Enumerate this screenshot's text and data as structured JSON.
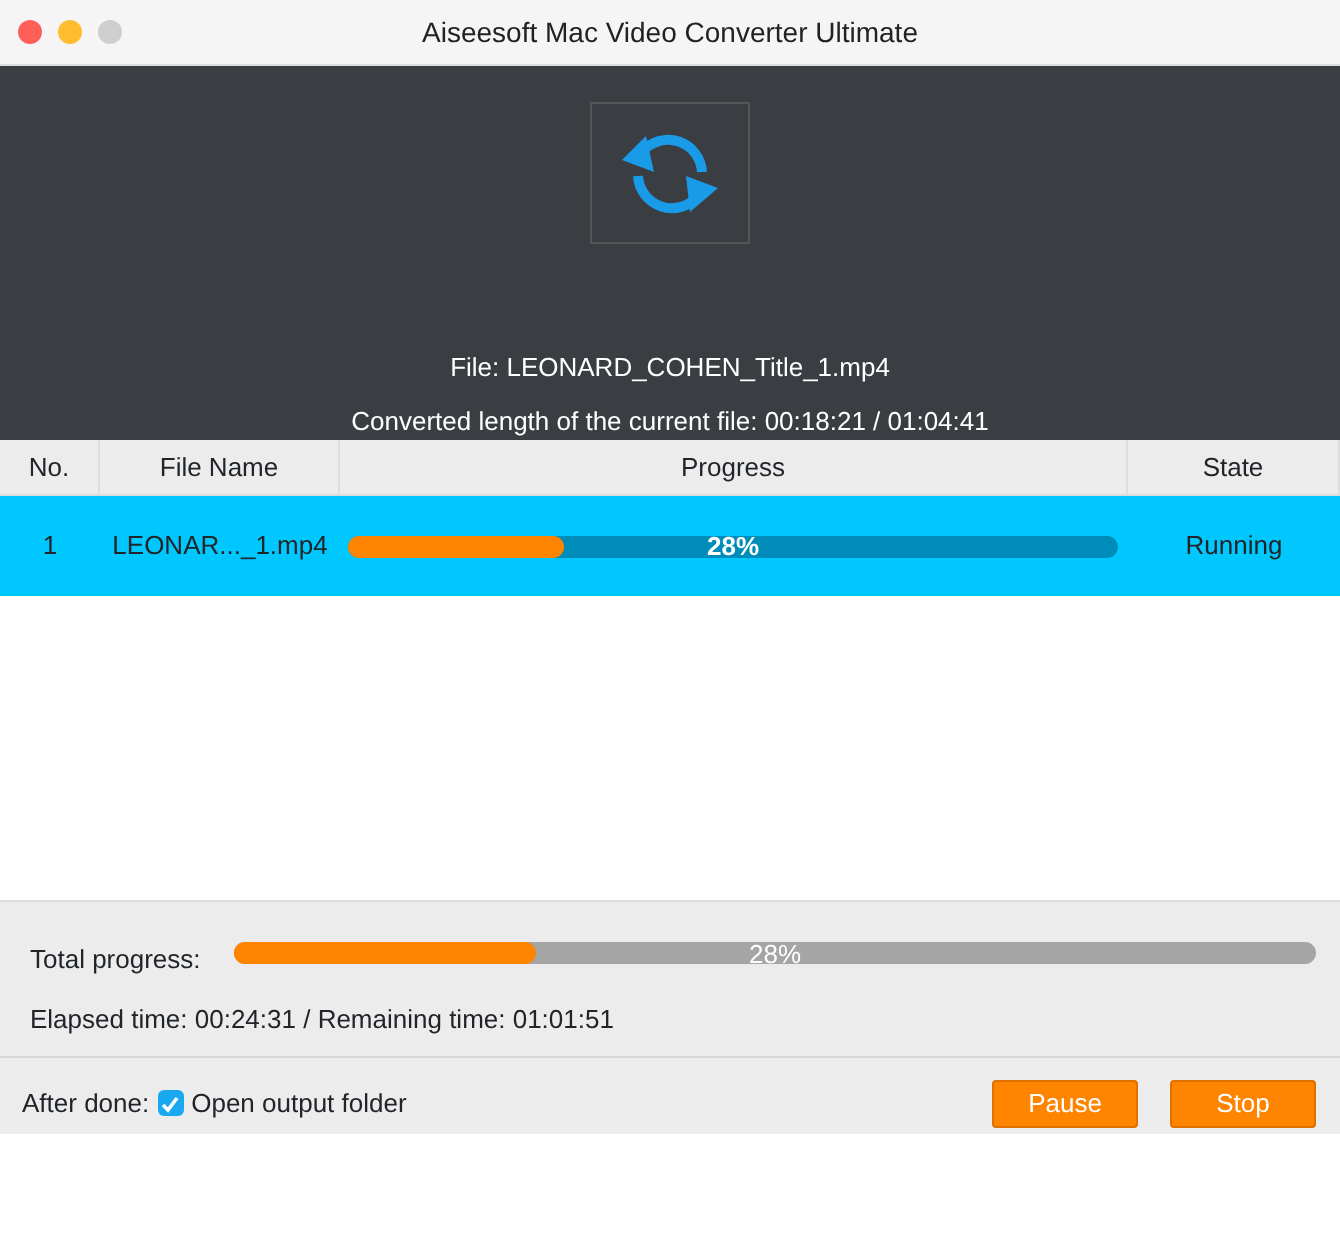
{
  "window": {
    "title": "Aiseesoft Mac Video Converter Ultimate"
  },
  "current": {
    "file": "File: LEONARD_COHEN_Title_1.mp4",
    "length": "Converted length of the current file: 00:18:21 / 01:04:41"
  },
  "table": {
    "columns": [
      "No.",
      "File Name",
      "Progress",
      "State"
    ],
    "rows": [
      {
        "no": "1",
        "file_name": "LEONAR..._1.mp4",
        "level": 0.28,
        "progress_text": "28%",
        "state": "Running",
        "selected": true
      }
    ]
  },
  "total": {
    "label": "Total progress:",
    "level": 0.28,
    "progress_text": "28%",
    "times": "Elapsed time: 00:24:31 / Remaining time: 01:01:51"
  },
  "after_done": {
    "label": "After done:",
    "option": "Open output folder",
    "checked": true
  },
  "buttons": [
    "Pause",
    "Stop"
  ]
}
